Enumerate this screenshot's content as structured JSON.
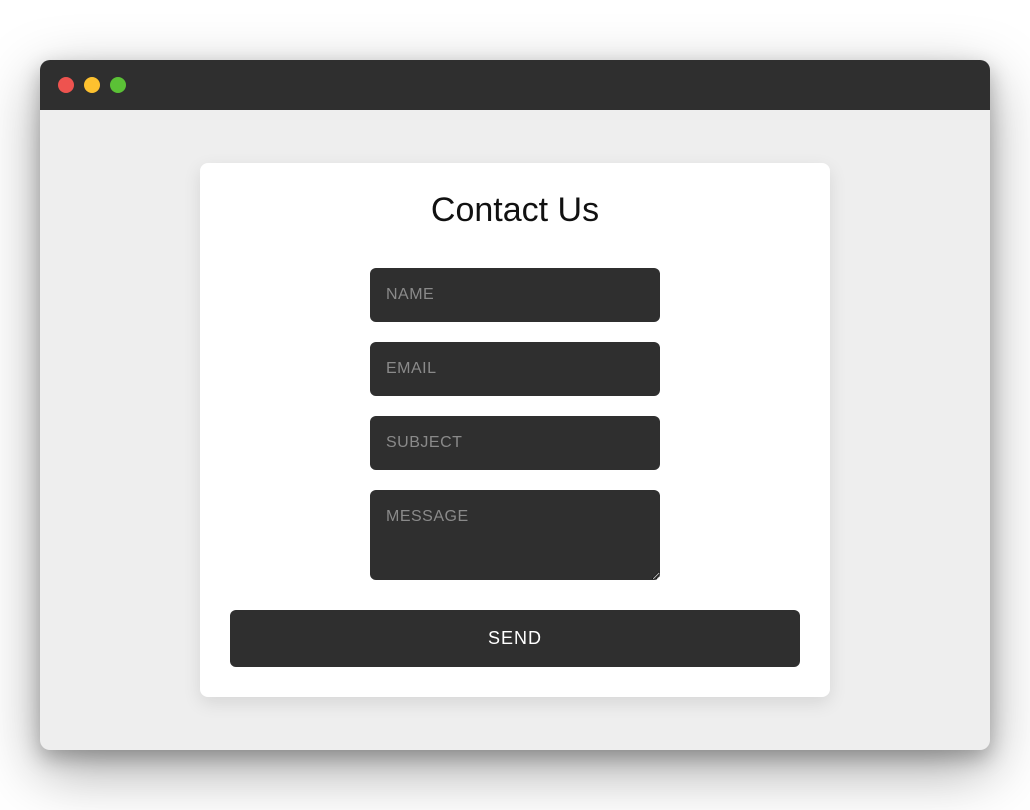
{
  "window": {
    "controls": {
      "close_color": "#ee534f",
      "minimize_color": "#fdc12f",
      "zoom_color": "#5bc136"
    }
  },
  "form": {
    "title": "Contact Us",
    "fields": {
      "name": {
        "placeholder": "NAME",
        "value": ""
      },
      "email": {
        "placeholder": "EMAIL",
        "value": ""
      },
      "subject": {
        "placeholder": "SUBJECT",
        "value": ""
      },
      "message": {
        "placeholder": "MESSAGE",
        "value": ""
      }
    },
    "submit_label": "SEND"
  }
}
